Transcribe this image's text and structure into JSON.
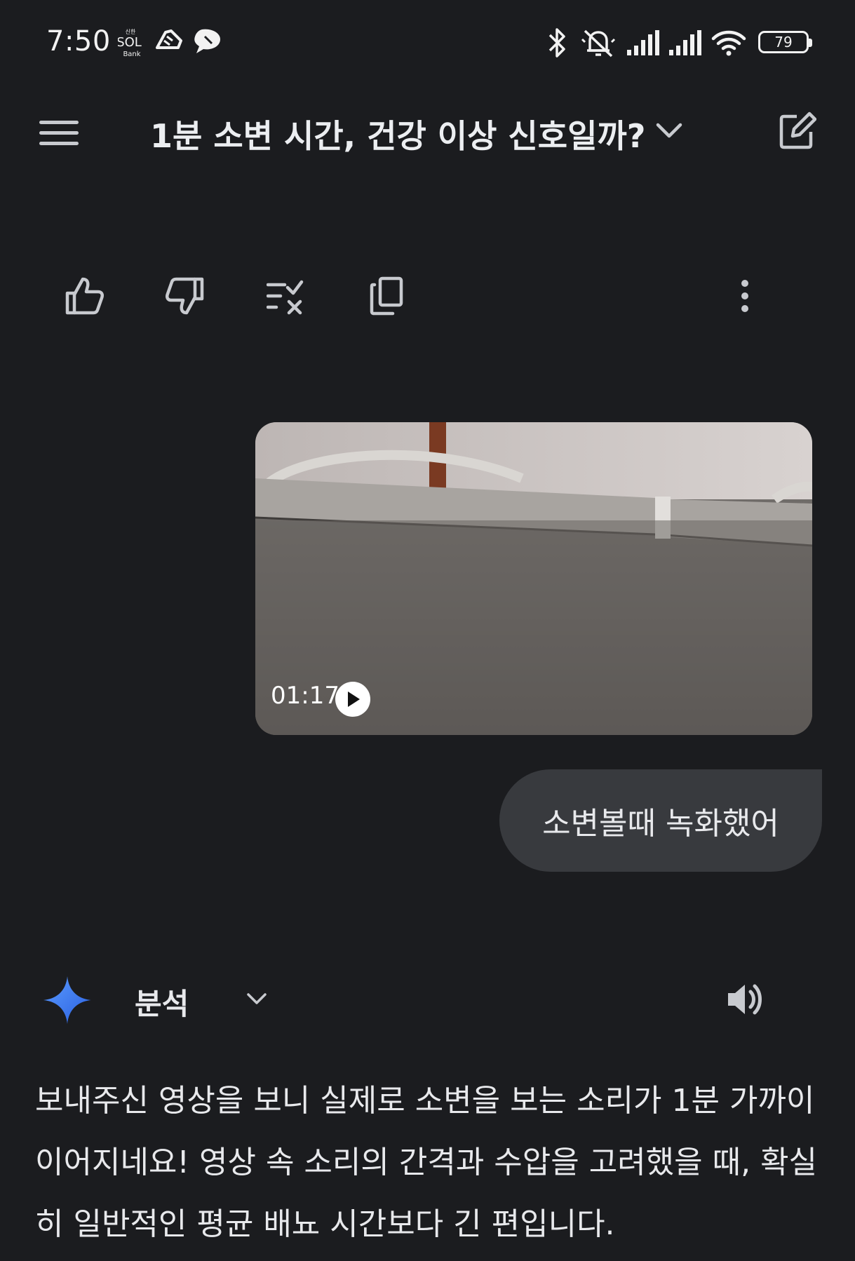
{
  "status_bar": {
    "time": "7:50",
    "app_icons": [
      "sol-bank-icon",
      "shoe-icon",
      "chat-bubble-icon"
    ],
    "right_icons": [
      "bluetooth-icon",
      "mute-icon",
      "signal-icon",
      "signal-icon",
      "wifi-icon"
    ],
    "battery": "79"
  },
  "header": {
    "title": "1분 소변 시간, 건강 이상 신호일까?",
    "icons": {
      "menu": "menu-icon",
      "dropdown": "chevron-down-icon",
      "new_chat": "edit-icon"
    }
  },
  "response_actions": [
    "thumbs-up-icon",
    "thumbs-down-icon",
    "compare-icon",
    "copy-icon",
    "more-vert-icon"
  ],
  "user_message": {
    "video": {
      "duration": "01:17"
    },
    "text": "소변볼때 녹화했어"
  },
  "model_response": {
    "label": "분석",
    "text": "보내주신 영상을 보니 실제로 소변을 보는 소리가 1분 가까이 이어지네요! 영상 속 소리의 간격과 수압을 고려했을 때, 확실히 일반적인 평균 배뇨 시간보다 긴 편입니다."
  },
  "colors": {
    "background": "#1b1c1f",
    "bubble": "#383a3e",
    "spark_from": "#4f8cf7",
    "spark_to": "#2a5fe0"
  }
}
